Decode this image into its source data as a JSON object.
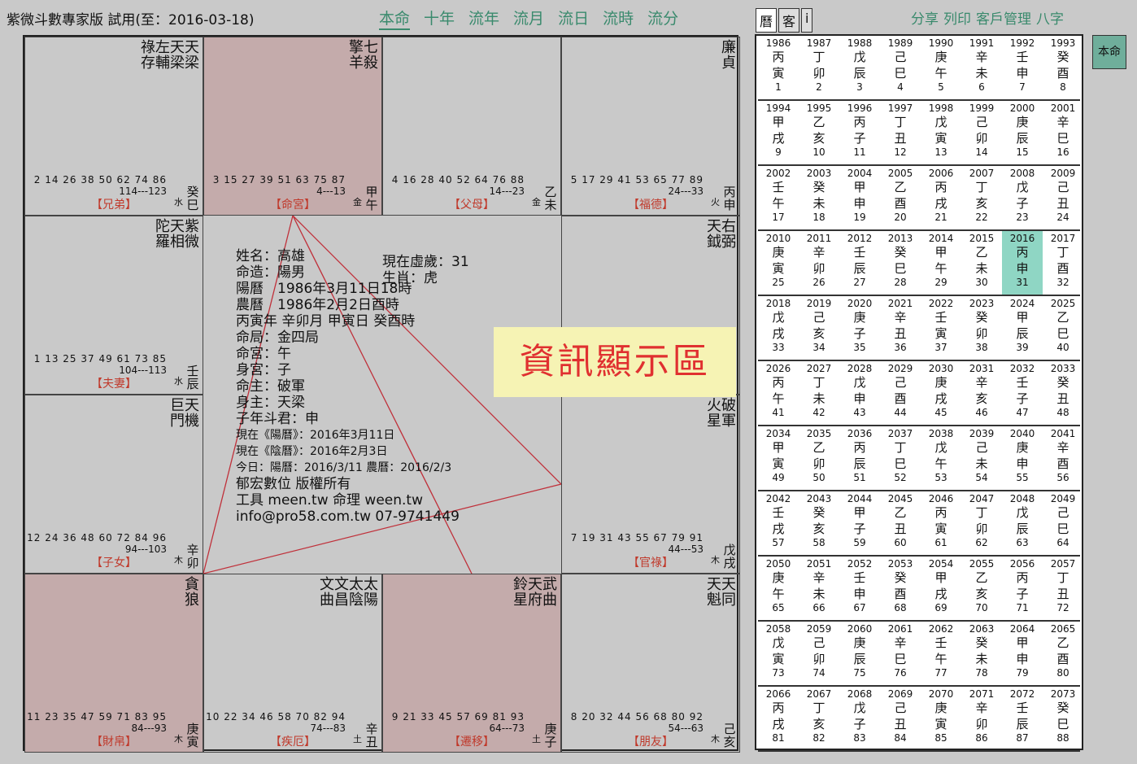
{
  "app": {
    "title": "紫微斗數專家版 試用(至：2016-03-18)"
  },
  "nav": [
    "本命",
    "十年",
    "流年",
    "流月",
    "流日",
    "流時",
    "流分"
  ],
  "right_tabs": [
    "曆",
    "客",
    "i"
  ],
  "actions": [
    "分享",
    "列印",
    "客戶管理",
    "八字"
  ],
  "benming_button": "本命",
  "banner": "資訊顯示區",
  "center": {
    "lines": [
      "姓名：高雄",
      "命造：陽男",
      "陽曆　1986年3月11日18時",
      "農曆　1986年2月2日酉時",
      "丙寅年 辛卯月 甲寅日 癸酉時",
      "命局：金四局",
      "命宮：午",
      "身宮：子",
      "命主：破軍",
      "身主：天梁",
      "子年斗君：申",
      "現在《陽曆》：2016年3月11日",
      "現在《陰曆》：2016年2月3日",
      "今日：陽曆：2016/3/11 農曆：2016/2/3",
      "郁宏數位 版權所有",
      "工具 meen.tw 命理 ween.tw",
      "info@pro58.com.tw 07-9741449"
    ],
    "age_label": "現在虛歲：31",
    "zodiac": "生肖：虎"
  },
  "palaces": [
    {
      "name": "【兄弟】",
      "gz": "癸巳",
      "wx": "水",
      "range": "114---123",
      "ages": "2 14 26 38 50 62 74 86",
      "stars": "祿左天天\n存輔梁梁",
      "ming": false
    },
    {
      "name": "【命宮】",
      "gz": "甲午",
      "wx": "金",
      "range": "4---13",
      "ages": "3 15 27 39 51 63 75 87",
      "stars": "擎七\n羊殺",
      "ming": true
    },
    {
      "name": "【父母】",
      "gz": "乙未",
      "wx": "金",
      "range": "14---23",
      "ages": "4 16 28 40 52 64 76 88",
      "stars": "",
      "ming": false
    },
    {
      "name": "【福德】",
      "gz": "丙申",
      "wx": "火",
      "range": "24---33",
      "ages": "5 17 29 41 53 65 77 89",
      "stars": "廉\n貞",
      "ming": false
    },
    {
      "name": "【夫妻】",
      "gz": "壬辰",
      "wx": "水",
      "range": "104---113",
      "ages": "1 13 25 37 49 61 73 85",
      "stars": "陀天紫\n羅相微",
      "ming": false
    },
    {
      "name": "【田宅】",
      "gz": "丁酉",
      "wx": "火",
      "range": "34---43",
      "ages": "6 18 30 42 54 66 78 90",
      "stars": "天右\n鉞弼",
      "ming": false
    },
    {
      "name": "【子女】",
      "gz": "辛卯",
      "wx": "木",
      "range": "94---103",
      "ages": "12 24 36 48 60 72 84 96",
      "stars": "巨天\n門機",
      "ming": false
    },
    {
      "name": "【官祿】",
      "gz": "戊戌",
      "wx": "木",
      "range": "44---53",
      "ages": "7 19 31 43 55 67 79 91",
      "stars": "火破\n星軍",
      "ming": false
    },
    {
      "name": "【財帛】",
      "gz": "庚寅",
      "wx": "木",
      "range": "84---93",
      "ages": "11 23 35 47 59 71 83 95",
      "stars": "貪\n狼",
      "ming": true
    },
    {
      "name": "【疾厄】",
      "gz": "辛丑",
      "wx": "土",
      "range": "74---83",
      "ages": "10 22 34 46 58 70 82 94",
      "stars": "文文太太\n曲昌陰陽",
      "ming": false
    },
    {
      "name": "【遷移】",
      "gz": "庚子",
      "wx": "土",
      "range": "64---73",
      "ages": "9 21 33 45 57 69 81 93",
      "stars": "鈴天武\n星府曲",
      "ming": true
    },
    {
      "name": "【朋友】",
      "gz": "己亥",
      "wx": "木",
      "range": "54---63",
      "ages": "8 20 32 44 56 68 80 92",
      "stars": "天天\n魁同",
      "ming": false
    }
  ],
  "calendar": [
    {
      "y": "1986",
      "g": "丙",
      "z": "寅",
      "a": "1"
    },
    {
      "y": "1987",
      "g": "丁",
      "z": "卯",
      "a": "2"
    },
    {
      "y": "1988",
      "g": "戊",
      "z": "辰",
      "a": "3"
    },
    {
      "y": "1989",
      "g": "己",
      "z": "巳",
      "a": "4"
    },
    {
      "y": "1990",
      "g": "庚",
      "z": "午",
      "a": "5"
    },
    {
      "y": "1991",
      "g": "辛",
      "z": "未",
      "a": "6"
    },
    {
      "y": "1992",
      "g": "壬",
      "z": "申",
      "a": "7"
    },
    {
      "y": "1993",
      "g": "癸",
      "z": "酉",
      "a": "8"
    },
    {
      "y": "1994",
      "g": "甲",
      "z": "戌",
      "a": "9"
    },
    {
      "y": "1995",
      "g": "乙",
      "z": "亥",
      "a": "10"
    },
    {
      "y": "1996",
      "g": "丙",
      "z": "子",
      "a": "11"
    },
    {
      "y": "1997",
      "g": "丁",
      "z": "丑",
      "a": "12"
    },
    {
      "y": "1998",
      "g": "戊",
      "z": "寅",
      "a": "13"
    },
    {
      "y": "1999",
      "g": "己",
      "z": "卯",
      "a": "14"
    },
    {
      "y": "2000",
      "g": "庚",
      "z": "辰",
      "a": "15"
    },
    {
      "y": "2001",
      "g": "辛",
      "z": "巳",
      "a": "16"
    },
    {
      "y": "2002",
      "g": "壬",
      "z": "午",
      "a": "17"
    },
    {
      "y": "2003",
      "g": "癸",
      "z": "未",
      "a": "18"
    },
    {
      "y": "2004",
      "g": "甲",
      "z": "申",
      "a": "19"
    },
    {
      "y": "2005",
      "g": "乙",
      "z": "酉",
      "a": "20"
    },
    {
      "y": "2006",
      "g": "丙",
      "z": "戌",
      "a": "21"
    },
    {
      "y": "2007",
      "g": "丁",
      "z": "亥",
      "a": "22"
    },
    {
      "y": "2008",
      "g": "戊",
      "z": "子",
      "a": "23"
    },
    {
      "y": "2009",
      "g": "己",
      "z": "丑",
      "a": "24"
    },
    {
      "y": "2010",
      "g": "庚",
      "z": "寅",
      "a": "25"
    },
    {
      "y": "2011",
      "g": "辛",
      "z": "卯",
      "a": "26"
    },
    {
      "y": "2012",
      "g": "壬",
      "z": "辰",
      "a": "27"
    },
    {
      "y": "2013",
      "g": "癸",
      "z": "巳",
      "a": "28"
    },
    {
      "y": "2014",
      "g": "甲",
      "z": "午",
      "a": "29"
    },
    {
      "y": "2015",
      "g": "乙",
      "z": "未",
      "a": "30"
    },
    {
      "y": "2016",
      "g": "丙",
      "z": "申",
      "a": "31"
    },
    {
      "y": "2017",
      "g": "丁",
      "z": "酉",
      "a": "32"
    },
    {
      "y": "2018",
      "g": "戊",
      "z": "戌",
      "a": "33"
    },
    {
      "y": "2019",
      "g": "己",
      "z": "亥",
      "a": "34"
    },
    {
      "y": "2020",
      "g": "庚",
      "z": "子",
      "a": "35"
    },
    {
      "y": "2021",
      "g": "辛",
      "z": "丑",
      "a": "36"
    },
    {
      "y": "2022",
      "g": "壬",
      "z": "寅",
      "a": "37"
    },
    {
      "y": "2023",
      "g": "癸",
      "z": "卯",
      "a": "38"
    },
    {
      "y": "2024",
      "g": "甲",
      "z": "辰",
      "a": "39"
    },
    {
      "y": "2025",
      "g": "乙",
      "z": "巳",
      "a": "40"
    },
    {
      "y": "2026",
      "g": "丙",
      "z": "午",
      "a": "41"
    },
    {
      "y": "2027",
      "g": "丁",
      "z": "未",
      "a": "42"
    },
    {
      "y": "2028",
      "g": "戊",
      "z": "申",
      "a": "43"
    },
    {
      "y": "2029",
      "g": "己",
      "z": "酉",
      "a": "44"
    },
    {
      "y": "2030",
      "g": "庚",
      "z": "戌",
      "a": "45"
    },
    {
      "y": "2031",
      "g": "辛",
      "z": "亥",
      "a": "46"
    },
    {
      "y": "2032",
      "g": "壬",
      "z": "子",
      "a": "47"
    },
    {
      "y": "2033",
      "g": "癸",
      "z": "丑",
      "a": "48"
    },
    {
      "y": "2034",
      "g": "甲",
      "z": "寅",
      "a": "49"
    },
    {
      "y": "2035",
      "g": "乙",
      "z": "卯",
      "a": "50"
    },
    {
      "y": "2036",
      "g": "丙",
      "z": "辰",
      "a": "51"
    },
    {
      "y": "2037",
      "g": "丁",
      "z": "巳",
      "a": "52"
    },
    {
      "y": "2038",
      "g": "戊",
      "z": "午",
      "a": "53"
    },
    {
      "y": "2039",
      "g": "己",
      "z": "未",
      "a": "54"
    },
    {
      "y": "2040",
      "g": "庚",
      "z": "申",
      "a": "55"
    },
    {
      "y": "2041",
      "g": "辛",
      "z": "酉",
      "a": "56"
    },
    {
      "y": "2042",
      "g": "壬",
      "z": "戌",
      "a": "57"
    },
    {
      "y": "2043",
      "g": "癸",
      "z": "亥",
      "a": "58"
    },
    {
      "y": "2044",
      "g": "甲",
      "z": "子",
      "a": "59"
    },
    {
      "y": "2045",
      "g": "乙",
      "z": "丑",
      "a": "60"
    },
    {
      "y": "2046",
      "g": "丙",
      "z": "寅",
      "a": "61"
    },
    {
      "y": "2047",
      "g": "丁",
      "z": "卯",
      "a": "62"
    },
    {
      "y": "2048",
      "g": "戊",
      "z": "辰",
      "a": "63"
    },
    {
      "y": "2049",
      "g": "己",
      "z": "巳",
      "a": "64"
    },
    {
      "y": "2050",
      "g": "庚",
      "z": "午",
      "a": "65"
    },
    {
      "y": "2051",
      "g": "辛",
      "z": "未",
      "a": "66"
    },
    {
      "y": "2052",
      "g": "壬",
      "z": "申",
      "a": "67"
    },
    {
      "y": "2053",
      "g": "癸",
      "z": "酉",
      "a": "68"
    },
    {
      "y": "2054",
      "g": "甲",
      "z": "戌",
      "a": "69"
    },
    {
      "y": "2055",
      "g": "乙",
      "z": "亥",
      "a": "70"
    },
    {
      "y": "2056",
      "g": "丙",
      "z": "子",
      "a": "71"
    },
    {
      "y": "2057",
      "g": "丁",
      "z": "丑",
      "a": "72"
    },
    {
      "y": "2058",
      "g": "戊",
      "z": "寅",
      "a": "73"
    },
    {
      "y": "2059",
      "g": "己",
      "z": "卯",
      "a": "74"
    },
    {
      "y": "2060",
      "g": "庚",
      "z": "辰",
      "a": "75"
    },
    {
      "y": "2061",
      "g": "辛",
      "z": "巳",
      "a": "76"
    },
    {
      "y": "2062",
      "g": "壬",
      "z": "午",
      "a": "77"
    },
    {
      "y": "2063",
      "g": "癸",
      "z": "未",
      "a": "78"
    },
    {
      "y": "2064",
      "g": "甲",
      "z": "申",
      "a": "79"
    },
    {
      "y": "2065",
      "g": "乙",
      "z": "酉",
      "a": "80"
    },
    {
      "y": "2066",
      "g": "丙",
      "z": "戌",
      "a": "81"
    },
    {
      "y": "2067",
      "g": "丁",
      "z": "亥",
      "a": "82"
    },
    {
      "y": "2068",
      "g": "戊",
      "z": "子",
      "a": "83"
    },
    {
      "y": "2069",
      "g": "己",
      "z": "丑",
      "a": "84"
    },
    {
      "y": "2070",
      "g": "庚",
      "z": "寅",
      "a": "85"
    },
    {
      "y": "2071",
      "g": "辛",
      "z": "卯",
      "a": "86"
    },
    {
      "y": "2072",
      "g": "壬",
      "z": "辰",
      "a": "87"
    },
    {
      "y": "2073",
      "g": "癸",
      "z": "巳",
      "a": "88"
    }
  ],
  "current_year": "2016"
}
